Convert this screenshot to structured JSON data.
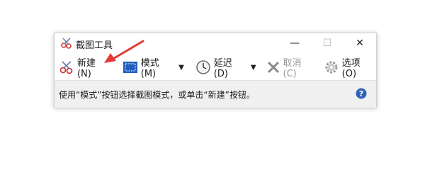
{
  "window": {
    "title": "截图工具",
    "min_glyph": "—",
    "max_glyph": "☐",
    "close_glyph": "✕"
  },
  "toolbar": {
    "new_label": "新建(N)",
    "mode_label": "模式(M)",
    "delay_label": "延迟(D)",
    "cancel_label": "取消(C)",
    "options_label": "选项(O)",
    "dropdown_glyph": "▼"
  },
  "status": {
    "text": "使用“模式”按钮选择截图模式，或单击“新建”按钮。"
  },
  "colors": {
    "arrow": "#e53935",
    "help": "#2f63b6",
    "accent": "#1f5fbf"
  },
  "icons": [
    "scissors-icon",
    "rectangle-mode-icon",
    "clock-icon",
    "cancel-x-icon",
    "gear-icon",
    "help-icon"
  ]
}
